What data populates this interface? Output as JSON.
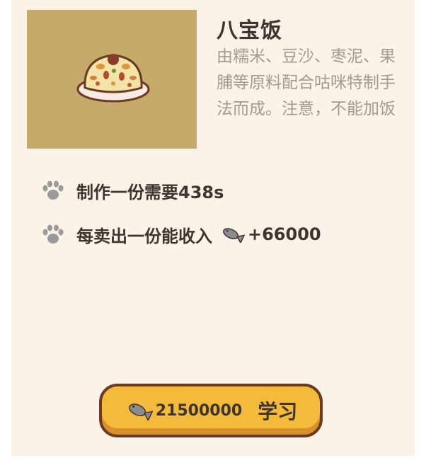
{
  "recipe": {
    "name": "八宝饭",
    "description": "由糯米、豆沙、枣泥、果脯等原料配合咕咪特制手法而成。注意，不能加饭",
    "image": "eight-treasure-rice"
  },
  "stats": {
    "make_time": "制作一份需要438s",
    "income_label": "每卖出一份能收入",
    "income_value": "+66000"
  },
  "learn": {
    "price": "21500000",
    "label": "学习"
  },
  "icons": {
    "stat_icon": "paw-icon",
    "currency_icon": "fish-icon"
  },
  "colors": {
    "background": "#fbf3e8",
    "image_bg": "#c6aa6a",
    "button": "#f4bb3b",
    "button_border": "#6b3a21",
    "text_dark": "#3f3530",
    "text_light": "#a59a8d"
  }
}
